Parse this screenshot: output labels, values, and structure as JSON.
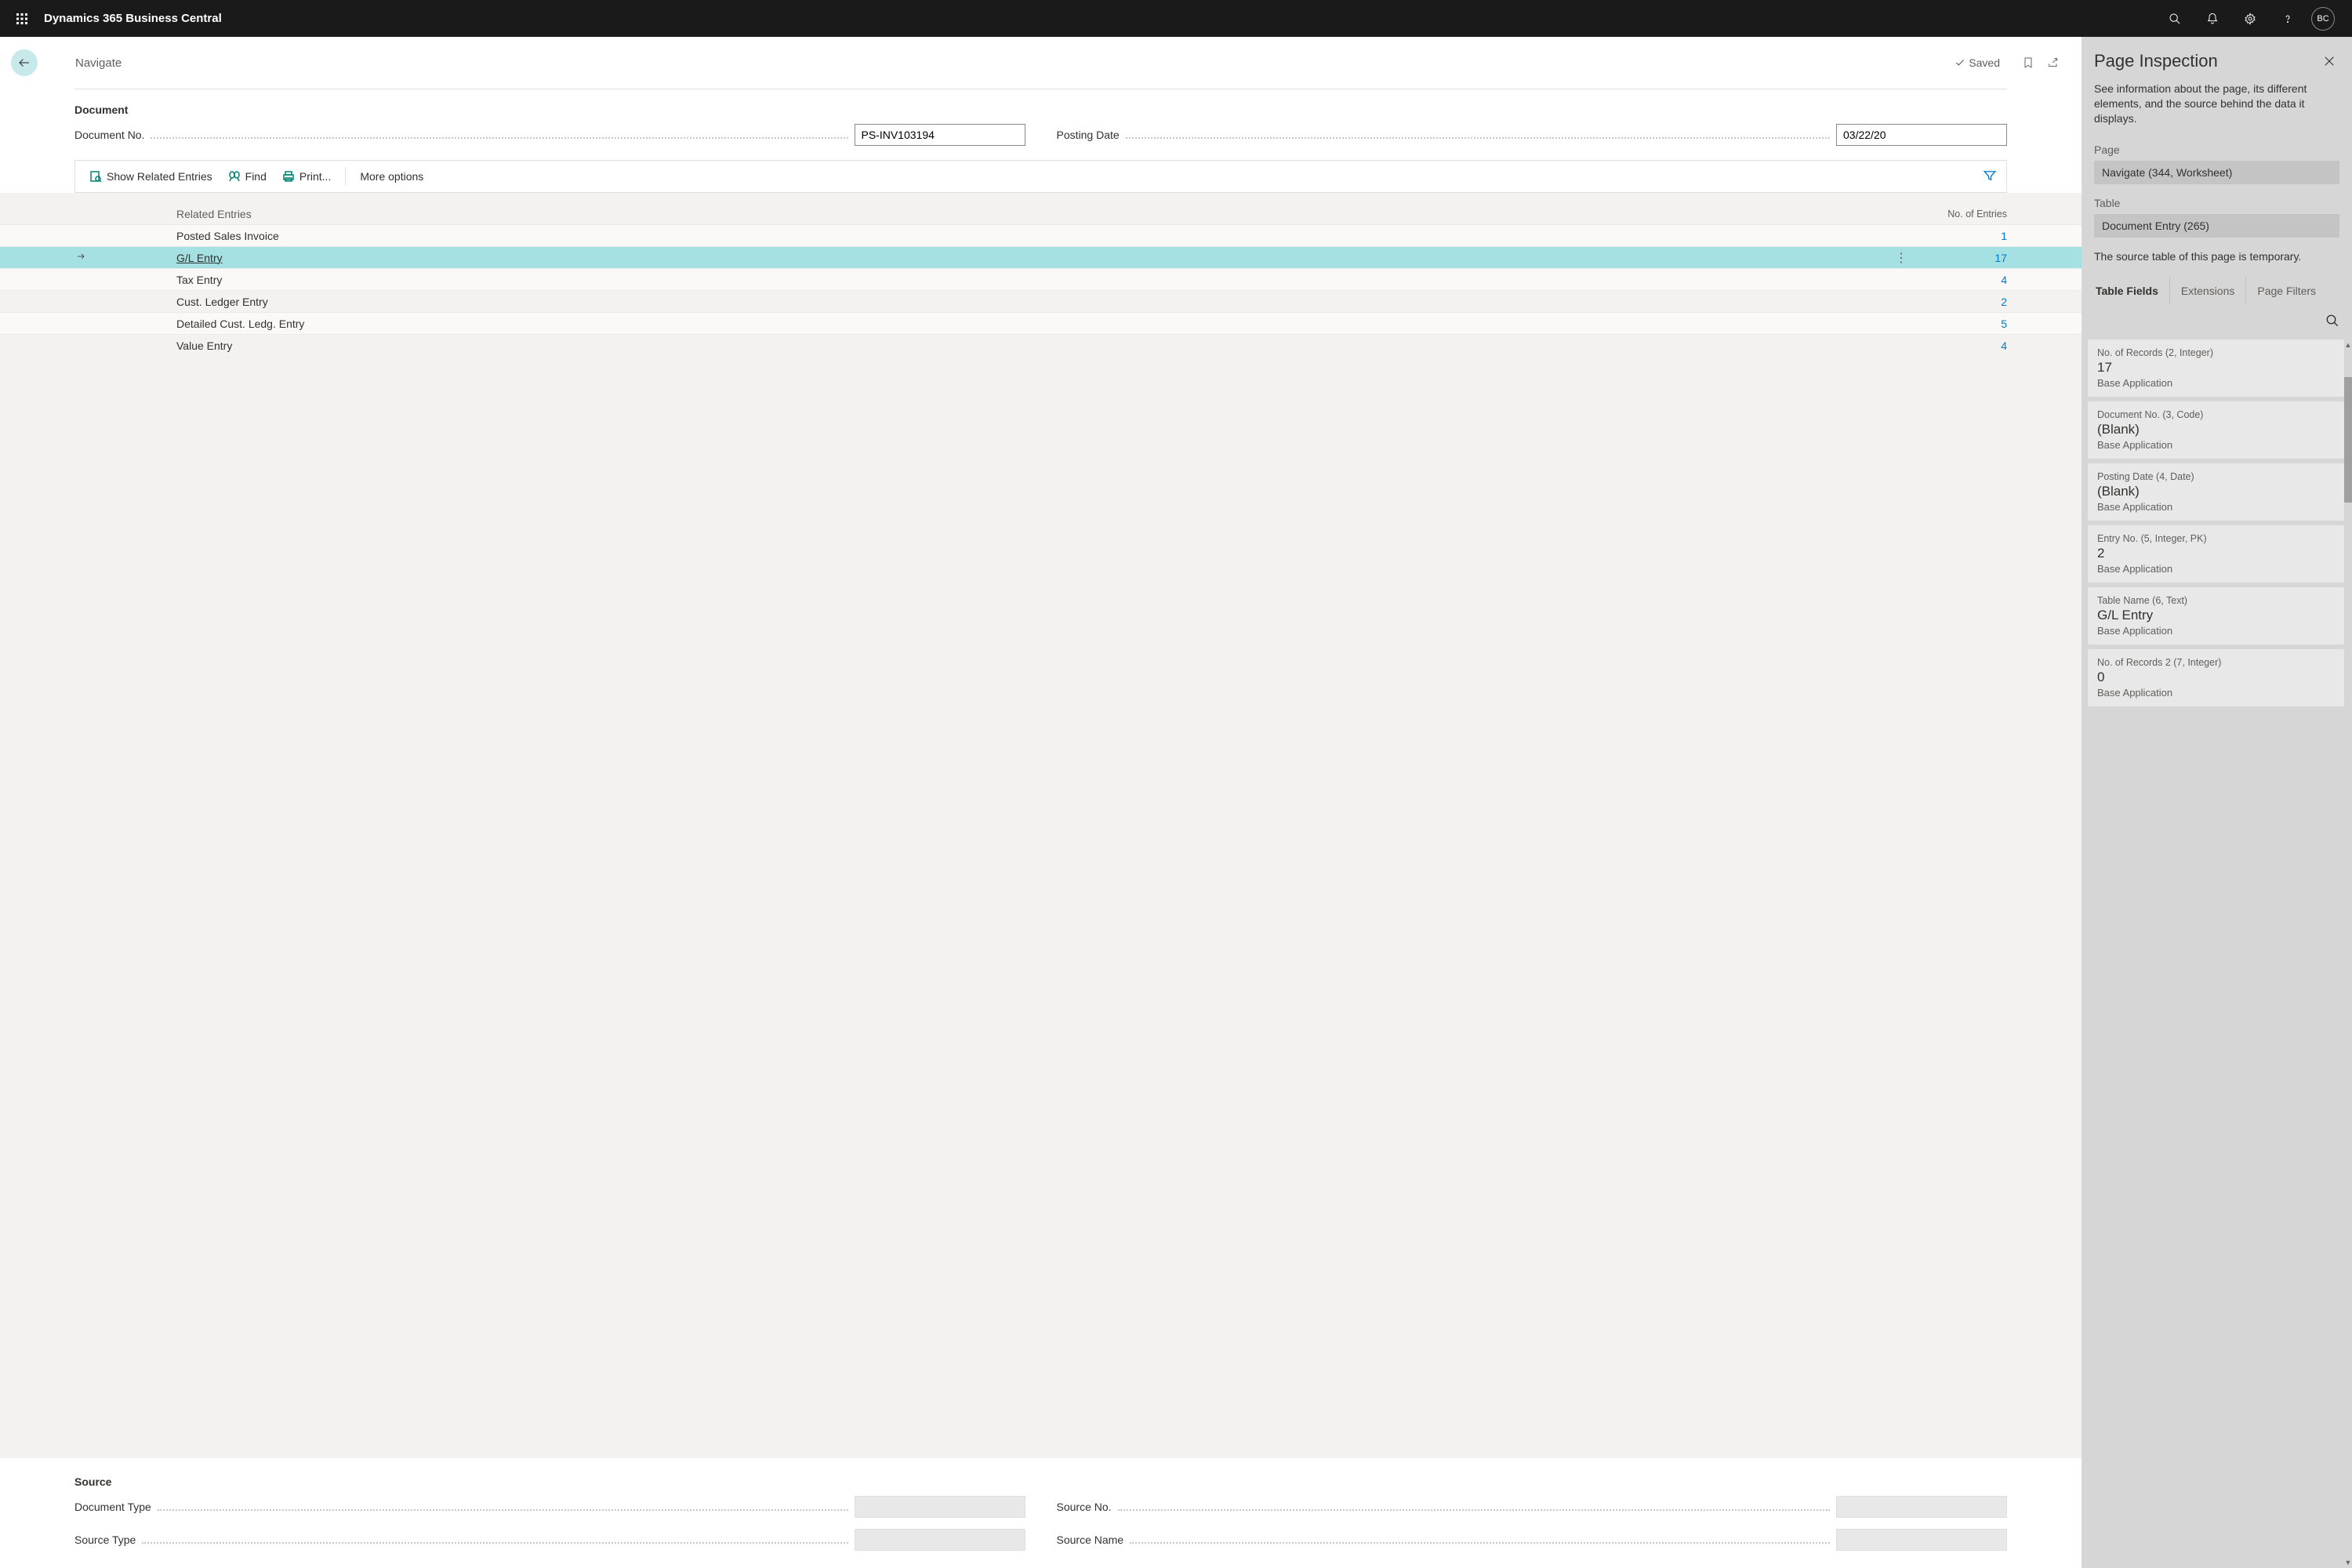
{
  "topbar": {
    "app_title": "Dynamics 365 Business Central",
    "avatar_initials": "BC"
  },
  "header": {
    "page_title": "Navigate",
    "saved_label": "Saved"
  },
  "document": {
    "section_title": "Document",
    "doc_no_label": "Document No.",
    "doc_no_value": "PS-INV103194",
    "posting_date_label": "Posting Date",
    "posting_date_value": "03/22/20"
  },
  "toolbar": {
    "show_related": "Show Related Entries",
    "find": "Find",
    "print": "Print...",
    "more_options": "More options"
  },
  "grid": {
    "col_related": "Related Entries",
    "col_count": "No. of Entries",
    "rows": [
      {
        "name": "Posted Sales Invoice",
        "count": "1",
        "selected": false
      },
      {
        "name": "G/L Entry",
        "count": "17",
        "selected": true
      },
      {
        "name": "Tax Entry",
        "count": "4",
        "selected": false
      },
      {
        "name": "Cust. Ledger Entry",
        "count": "2",
        "selected": false
      },
      {
        "name": "Detailed Cust. Ledg. Entry",
        "count": "5",
        "selected": false
      },
      {
        "name": "Value Entry",
        "count": "4",
        "selected": false
      }
    ]
  },
  "source": {
    "section_title": "Source",
    "doc_type_label": "Document Type",
    "source_type_label": "Source Type",
    "source_no_label": "Source No.",
    "source_name_label": "Source Name"
  },
  "inspector": {
    "title": "Page Inspection",
    "description": "See information about the page, its different elements, and the source behind the data it displays.",
    "page_label": "Page",
    "page_value": "Navigate (344, Worksheet)",
    "table_label": "Table",
    "table_value": "Document Entry (265)",
    "temp_note": "The source table of this page is temporary.",
    "tabs": {
      "fields": "Table Fields",
      "extensions": "Extensions",
      "filters": "Page Filters"
    },
    "fields": [
      {
        "label": "No. of Records (2, Integer)",
        "value": "17",
        "ext": "Base Application"
      },
      {
        "label": "Document No. (3, Code)",
        "value": "(Blank)",
        "ext": "Base Application"
      },
      {
        "label": "Posting Date (4, Date)",
        "value": "(Blank)",
        "ext": "Base Application"
      },
      {
        "label": "Entry No. (5, Integer, PK)",
        "value": "2",
        "ext": "Base Application"
      },
      {
        "label": "Table Name (6, Text)",
        "value": "G/L Entry",
        "ext": "Base Application"
      },
      {
        "label": "No. of Records 2 (7, Integer)",
        "value": "0",
        "ext": "Base Application"
      }
    ]
  }
}
